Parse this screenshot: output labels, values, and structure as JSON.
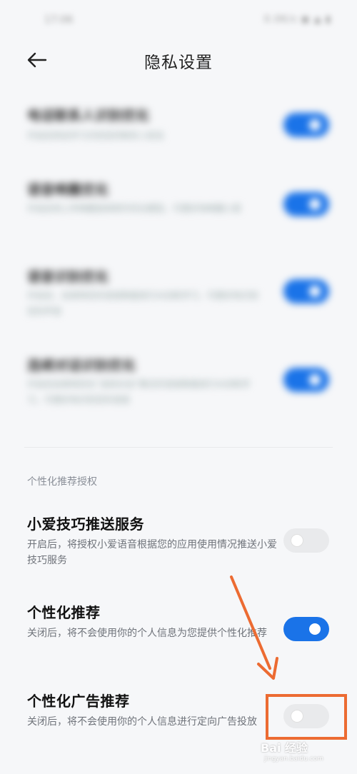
{
  "status_bar": {
    "time": "17:06",
    "indicators": "0.0K/s ▣ ▲ ▮"
  },
  "header": {
    "title": "隐私设置",
    "back_icon": "arrow-left-icon"
  },
  "blurred_items": [
    {
      "title": "电话联系人识别优化",
      "desc": "开启后将会学习识别您的联系人姓名",
      "enabled": true
    },
    {
      "title": "语音唤醒优化",
      "desc": "开启后将上传唤醒音频用作优化模型，可更好地唤醒小爱",
      "enabled": true
    },
    {
      "title": "语音识别优化",
      "desc": "开启后，会使用您的语音数据进行AI训练学习，可更好地识别您的声音",
      "enabled": true
    },
    {
      "title": "连续对话识别优化",
      "desc": "开启后会使用您在“连续对话”模式的语音数据进行AI训练学习，可更好地识别您的语音",
      "enabled": true
    }
  ],
  "section": {
    "label": "个性化推荐授权"
  },
  "items": [
    {
      "title": "小爱技巧推送服务",
      "desc": "开启后，将授权小爱语音根据您的应用使用情况推送小爱技巧服务",
      "enabled": false
    },
    {
      "title": "个性化推荐",
      "desc": "关闭后，将不会使用你的个人信息为您提供个性化推荐",
      "enabled": true
    },
    {
      "title": "个性化广告推荐",
      "desc": "关闭后，将不会使用你的个人信息进行定向广告投放",
      "enabled": false
    }
  ],
  "annotation": {
    "color": "#ec6b32"
  },
  "watermark": {
    "logo": "Bai 经验",
    "sub": "jingyan.baidu.com"
  },
  "colors": {
    "toggle_on": "#1a73e8",
    "toggle_off": "#e9eaec"
  }
}
